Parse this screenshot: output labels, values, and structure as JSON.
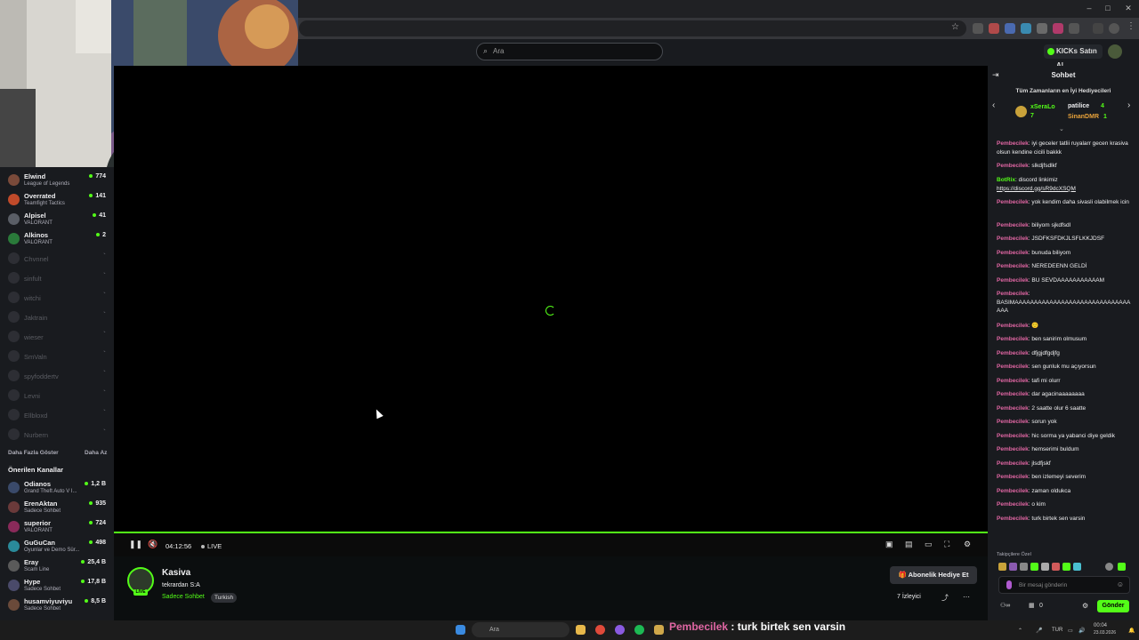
{
  "browser": {
    "window_controls": [
      "–",
      "□",
      "✕"
    ]
  },
  "header": {
    "search_placeholder": "Ara",
    "buy_kicks_label": "KICKs Satın Al"
  },
  "sidebar": {
    "followed": [
      {
        "name": "Elwind",
        "game": "League of Legends",
        "viewers": "774",
        "color": "#7a4a3a",
        "online": true
      },
      {
        "name": "Overrated",
        "game": "Teamfight Tactics",
        "viewers": "141",
        "color": "#c04a2a",
        "online": true
      },
      {
        "name": "Alpisel",
        "game": "VALORANT",
        "viewers": "41",
        "color": "#5a5e66",
        "online": true
      },
      {
        "name": "Alkinos",
        "game": "VALORANT",
        "viewers": "2",
        "color": "#2a7a3a",
        "online": true
      },
      {
        "name": "Chvnnel",
        "online": false
      },
      {
        "name": "sinfult",
        "online": false
      },
      {
        "name": "witchi",
        "online": false
      },
      {
        "name": "Jaktrain",
        "online": false
      },
      {
        "name": "wieser",
        "online": false
      },
      {
        "name": "SmValn",
        "online": false
      },
      {
        "name": "spyfoddertv",
        "online": false
      },
      {
        "name": "Levni",
        "online": false
      },
      {
        "name": "Ellbloxd",
        "online": false
      },
      {
        "name": "Nurbern",
        "online": false
      }
    ],
    "show_more": "Daha Fazla Göster",
    "show_less": "Daha Az",
    "recommended_title": "Önerilen Kanallar",
    "recommended": [
      {
        "name": "Odianos",
        "game": "Grand Theft Auto V I...",
        "viewers": "1,2 B",
        "color": "#3a4a6a"
      },
      {
        "name": "ErenAktan",
        "game": "Sadece Sohbet",
        "viewers": "935",
        "color": "#6a3a3a"
      },
      {
        "name": "superior",
        "game": "VALORANT",
        "viewers": "724",
        "color": "#8a2a5a"
      },
      {
        "name": "GuGuCan",
        "game": "Oyunlar ve Demo Sür...",
        "viewers": "498",
        "color": "#2a8a9a"
      },
      {
        "name": "Eray",
        "game": "Scam Line",
        "viewers": "25,4 B",
        "color": "#5a5a5a"
      },
      {
        "name": "Hype",
        "game": "Sadece Sohbet",
        "viewers": "17,8 B",
        "color": "#4a4a6a"
      },
      {
        "name": "husamviyuviyu",
        "game": "Sadece Sohbet",
        "viewers": "8,5 B",
        "color": "#6a4a3a"
      }
    ]
  },
  "player": {
    "time": "04:12:56",
    "live_label": "LIVE"
  },
  "stream": {
    "streamer": "Kasiva",
    "title": "tekrardan S:A",
    "category": "Sadece Sohbet",
    "tag": "Turkish",
    "live_badge": "LIVE",
    "gift_sub_label": "Abonelik Hediye Et",
    "viewers": "7 İzleyici"
  },
  "chat": {
    "title": "Sohbet",
    "top_gifters_title": "Tüm Zamanların en İyi Hediyecileri",
    "gifters": [
      {
        "name": "xSeraLo",
        "count": "7"
      },
      {
        "name": "patilice",
        "count": "4"
      },
      {
        "name": "SinanDMR",
        "count": "1"
      }
    ],
    "messages": [
      {
        "user": "Pembecilek",
        "text": "iyi geceler tatlii ruyalarr gecen krasiva olsun kendine cicili bakkk"
      },
      {
        "user": "Pembecilek",
        "text": "slkdjfsdlkf"
      },
      {
        "user": "BotRix",
        "text": "discord linkimiz",
        "link": "https://discord.gg/sR9dcXSQM",
        "bot": true
      },
      {
        "user": "Pembecilek",
        "text": "yok kendim daha sivasli olabilmek icin"
      },
      {
        "user": "Pembecilek",
        "text": "biliyom sjkdfsdl"
      },
      {
        "user": "Pembecilek",
        "text": "JSDFKSFDKJLSFLKKJDSF"
      },
      {
        "user": "Pembecilek",
        "text": "bunuda biliyom"
      },
      {
        "user": "Pembecilek",
        "text": "NEREDEENN GELDİ"
      },
      {
        "user": "Pembecilek",
        "text": "BU SEVDAAAAAAAAAAAM"
      },
      {
        "user": "Pembecilek",
        "text": "BASIMAAAAAAAAAAAAAAAAAAAAAAAAAAAAAAAAA"
      },
      {
        "user": "Pembecilek",
        "text": "🙂"
      },
      {
        "user": "Pembecilek",
        "text": "ben sanirim olmusum"
      },
      {
        "user": "Pembecilek",
        "text": "dfjgjdfgdjfg"
      },
      {
        "user": "Pembecilek",
        "text": "sen gunluk mu açıyorsun"
      },
      {
        "user": "Pembecilek",
        "text": "tafi mi olurr"
      },
      {
        "user": "Pembecilek",
        "text": "dar agacinaaaaaaaa"
      },
      {
        "user": "Pembecilek",
        "text": "2 saatte olur 6 saatte"
      },
      {
        "user": "Pembecilek",
        "text": "sorun yok"
      },
      {
        "user": "Pembecilek",
        "text": "hic sorma ya yabanci diye geldik"
      },
      {
        "user": "Pembecilek",
        "text": "hemserimi buldum"
      },
      {
        "user": "Pembecilek",
        "text": "jlsdfjskf"
      },
      {
        "user": "Pembecilek",
        "text": "ben izlemeyi severim"
      },
      {
        "user": "Pembecilek",
        "text": "zaman oldukca"
      },
      {
        "user": "Pembecilek",
        "text": "o kim"
      },
      {
        "user": "Pembecilek",
        "text": "turk birtek sen varsin"
      }
    ],
    "followers_only": "Takipçilere Özel",
    "input_placeholder": "Bir mesaj gönderin",
    "send_label": "Gönder",
    "bottom_count": "0"
  },
  "taskbar": {
    "search_placeholder": "Ara",
    "caption_user": "Pembecilek",
    "caption_text": " : turk birtek sen varsin",
    "lang": "TUR",
    "time": "00:04",
    "date": "23.03.2026"
  },
  "colors": {
    "accent": "#53fc18",
    "username": "#e066a3",
    "background": "#0b0e0f",
    "panel": "#191b1f"
  }
}
